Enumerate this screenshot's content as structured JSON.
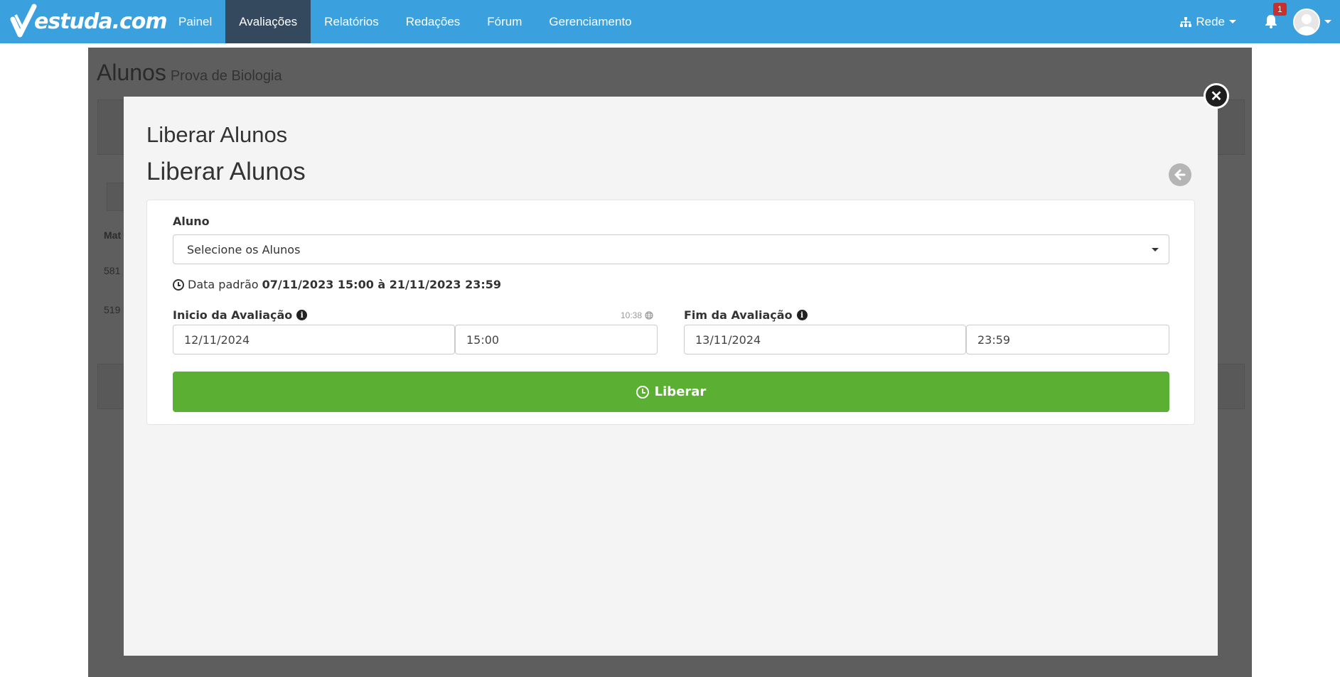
{
  "navbar": {
    "logo_text": "estuda.com",
    "items": [
      {
        "label": "Painel",
        "active": false
      },
      {
        "label": "Avaliações",
        "active": true
      },
      {
        "label": "Relatórios",
        "active": false
      },
      {
        "label": "Redações",
        "active": false
      },
      {
        "label": "Fórum",
        "active": false
      },
      {
        "label": "Gerenciamento",
        "active": false
      }
    ],
    "rede_label": "Rede",
    "notification_count": "1",
    "brand_color": "#3aa0de",
    "active_color": "#34495e"
  },
  "background_page": {
    "title": "Alunos",
    "subtitle": "Prova de Biologia",
    "rows": [
      "581",
      "519"
    ],
    "column_header": "Mat"
  },
  "modal": {
    "title": "Liberar Alunos",
    "heading": "Liberar Alunos",
    "aluno_label": "Aluno",
    "aluno_placeholder": "Selecione os Alunos",
    "default_date_prefix": "Data padrão",
    "default_date_value": "07/11/2023 15:00 à 21/11/2023 23:59",
    "inicio_label": "Inicio da Avaliação",
    "server_time": "10:38",
    "inicio_date": "12/11/2024",
    "inicio_time": "15:00",
    "fim_label": "Fim da Avaliação",
    "fim_date": "13/11/2024",
    "fim_time": "23:59",
    "submit_label": "Liberar",
    "submit_color": "#5baf32"
  }
}
